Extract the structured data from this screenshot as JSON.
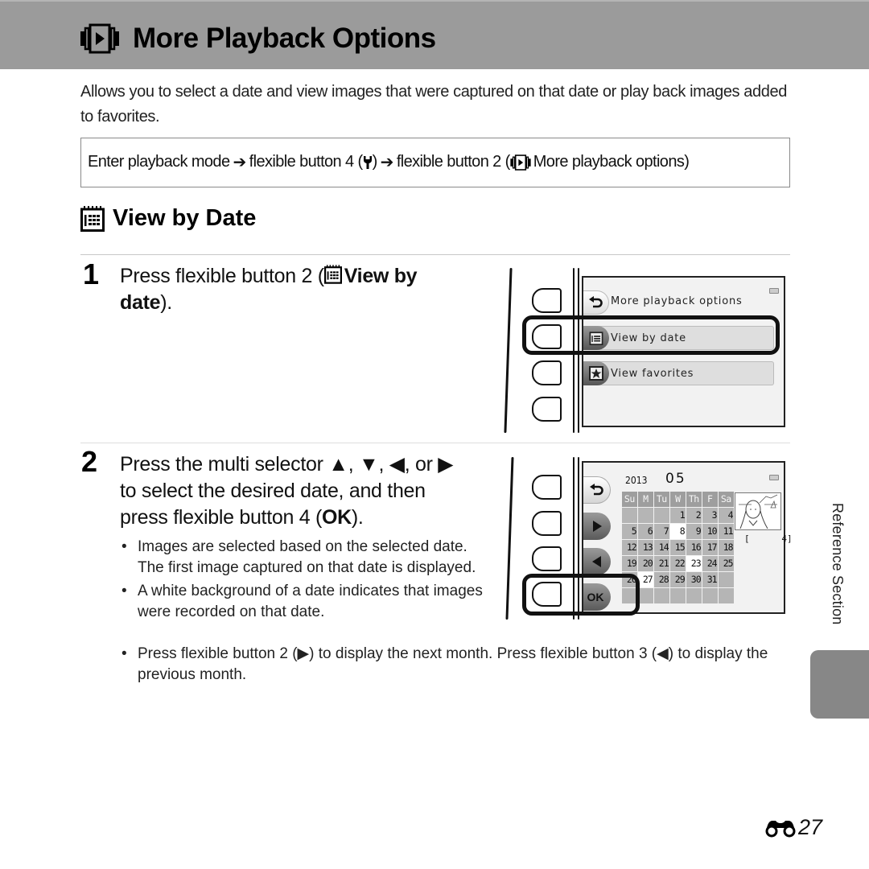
{
  "header": {
    "icon": "more-playback-options-icon",
    "title": "More Playback Options"
  },
  "intro": "Allows you to select a date and view images that were captured on that date or play back images added to favorites.",
  "nav_path": {
    "part1": "Enter playback mode",
    "arrow": "➔",
    "part2": "flexible button 4 (",
    "part2_icon": "wrench-icon",
    "part2_end": ")",
    "part3": "flexible button 2 (",
    "part3_icon": "more-playback-options-icon",
    "part3_label": "More playback options",
    "part3_end": ")"
  },
  "section": {
    "icon": "calendar-icon",
    "title": "View by Date"
  },
  "steps": [
    {
      "number": "1",
      "text_pre": "Press flexible button 2 (",
      "icon": "calendar-icon",
      "text_bold": "View by date",
      "text_post": ")."
    },
    {
      "number": "2",
      "line1_pre": "Press the multi selector ",
      "arrows": [
        "▲",
        "▼",
        "◀",
        "▶"
      ],
      "sep1": ", ",
      "sep2": ", ",
      "sep3": ", or ",
      "line2": "to select the desired date, and then",
      "line3_pre": "press flexible button 4 (",
      "line3_bold": "OK",
      "line3_post": ").",
      "bullets": [
        "Images are selected based on the selected date. The first image captured on that date is displayed.",
        "A white background of a date indicates that images were recorded on that date."
      ]
    }
  ],
  "footer_bullet": {
    "pre": "Press flexible button 2 (",
    "icon1": "▶",
    "mid": ") to display the next month. Press flexible button 3 (",
    "icon2": "◀",
    "post": ") to display the previous month."
  },
  "screen1": {
    "menu": [
      {
        "icon": "back-icon",
        "label": "More playback options",
        "selected": false
      },
      {
        "icon": "calendar-icon",
        "label": "View by date",
        "selected": true
      },
      {
        "icon": "favorites-star-icon",
        "label": "View favorites",
        "selected": false
      }
    ],
    "highlighted_button": 2
  },
  "screen2": {
    "year": "2013",
    "month": "05",
    "weekdays": [
      "Su",
      "M",
      "Tu",
      "W",
      "Th",
      "F",
      "Sa"
    ],
    "weeks": [
      [
        "",
        "",
        "",
        "1",
        "2",
        "3",
        "4"
      ],
      [
        "5",
        "6",
        "7",
        "8",
        "9",
        "10",
        "11"
      ],
      [
        "12",
        "13",
        "14",
        "15",
        "16",
        "17",
        "18"
      ],
      [
        "19",
        "20",
        "21",
        "22",
        "23",
        "24",
        "25"
      ],
      [
        "26",
        "27",
        "28",
        "29",
        "30",
        "31",
        ""
      ],
      [
        "",
        "",
        "",
        "",
        "",
        "",
        ""
      ]
    ],
    "dates_with_images": [
      "8",
      "23",
      "27"
    ],
    "image_count": "[      4]",
    "side_buttons": [
      "back-icon",
      "next-month-icon",
      "prev-month-icon",
      "OK"
    ],
    "highlighted_button": 4
  },
  "side_label": "Reference Section",
  "page_number": {
    "icon": "binoculars-icon",
    "number": "27"
  }
}
